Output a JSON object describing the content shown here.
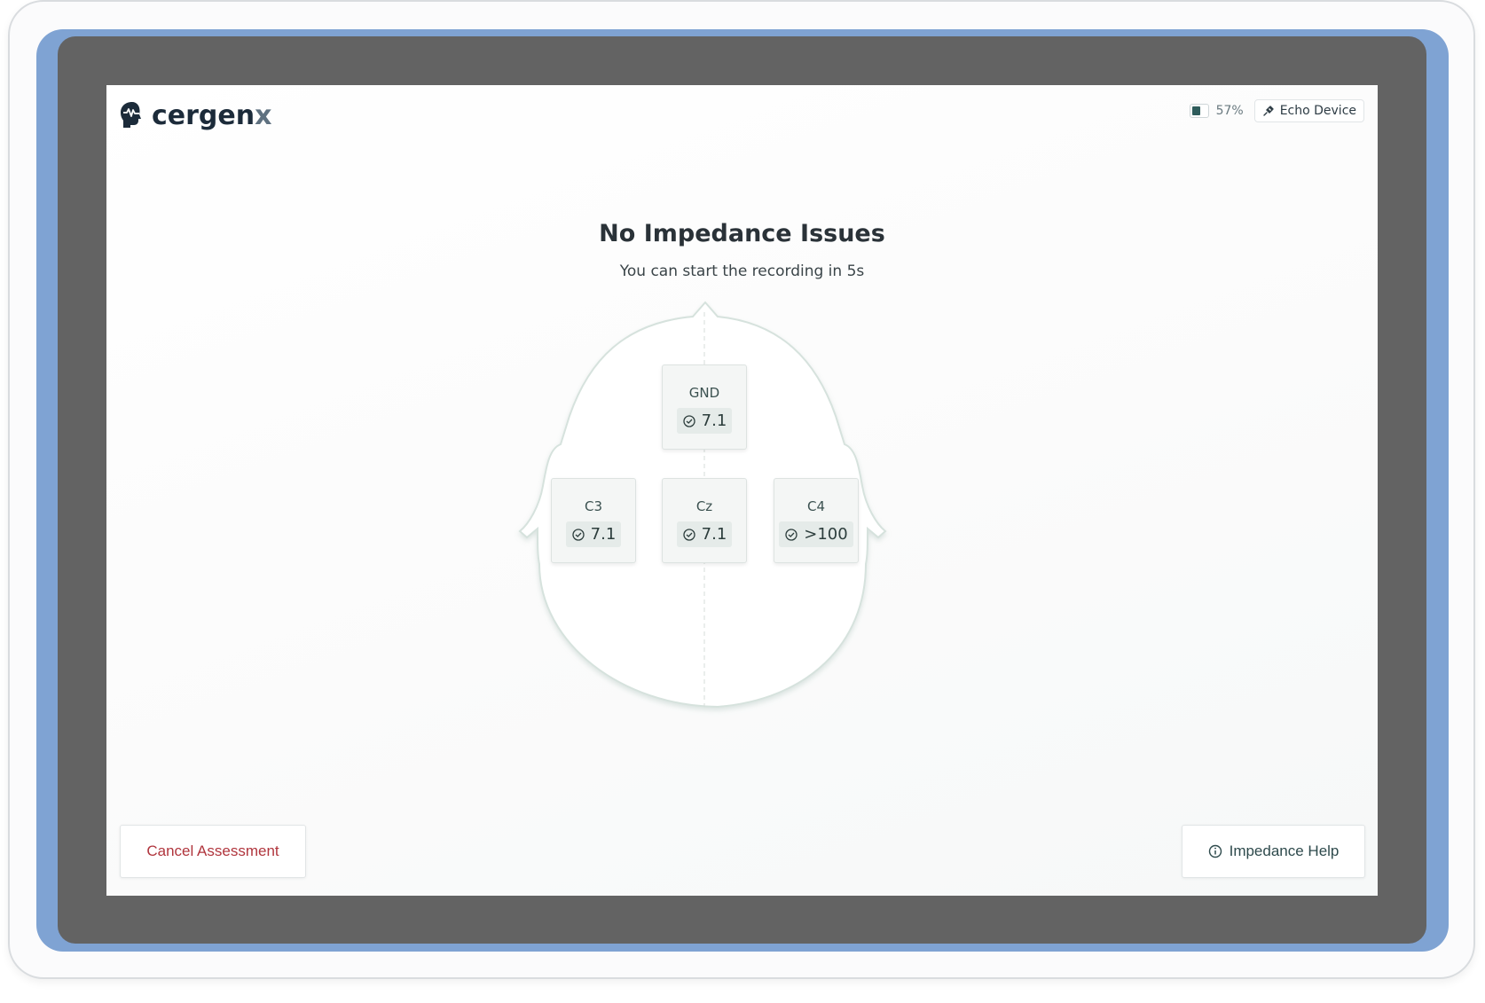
{
  "header": {
    "logo_text_main": "cergen",
    "logo_text_accent": "x",
    "battery": {
      "percent_label": "57%",
      "level": 0.57
    },
    "device": {
      "label": "Echo Device",
      "icon": "link-icon"
    }
  },
  "main": {
    "title": "No Impedance Issues",
    "subtitle": "You can start the recording in 5s"
  },
  "electrodes": {
    "gnd": {
      "name": "GND",
      "value": "7.1",
      "icon": "check-circle-icon"
    },
    "c3": {
      "name": "C3",
      "value": "7.1",
      "icon": "check-circle-icon"
    },
    "cz": {
      "name": "Cz",
      "value": "7.1",
      "icon": "check-circle-icon"
    },
    "c4": {
      "name": "C4",
      "value": ">100",
      "icon": "check-circle-icon"
    }
  },
  "footer": {
    "cancel_label": "Cancel Assessment",
    "help_label": "Impedance Help",
    "help_icon": "info-icon"
  },
  "colors": {
    "tablet_frame": "#7fa3d3",
    "bezel": "#636363",
    "brand_dark": "#1c2b3a",
    "cancel_text": "#b0353d",
    "battery_fill": "#2e5c5b"
  }
}
